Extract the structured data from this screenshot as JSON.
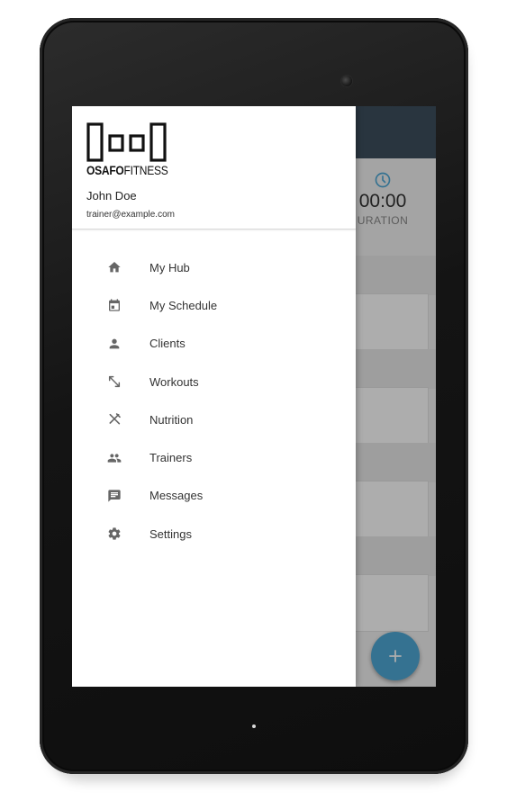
{
  "brand": {
    "name_bold": "OSAFO",
    "name_light": "FITNESS"
  },
  "user": {
    "name": "John Doe",
    "email": "trainer@example.com"
  },
  "menu": {
    "items": [
      {
        "label": "My Hub",
        "icon": "home-icon"
      },
      {
        "label": "My Schedule",
        "icon": "calendar-icon"
      },
      {
        "label": "Clients",
        "icon": "person-icon"
      },
      {
        "label": "Workouts",
        "icon": "expand-arrows-icon"
      },
      {
        "label": "Nutrition",
        "icon": "fork-knife-icon"
      },
      {
        "label": "Trainers",
        "icon": "people-icon"
      },
      {
        "label": "Messages",
        "icon": "chat-icon"
      },
      {
        "label": "Settings",
        "icon": "gear-icon"
      }
    ]
  },
  "background_app": {
    "stat_value": "00:00",
    "stat_label": "URATION",
    "stat_icon": "clock-icon",
    "fab_icon": "plus-icon"
  },
  "colors": {
    "app_bar": "#3d4f5e",
    "accent": "#4ea8d6",
    "drawer_bg": "#ffffff",
    "device_body": "#141414"
  }
}
